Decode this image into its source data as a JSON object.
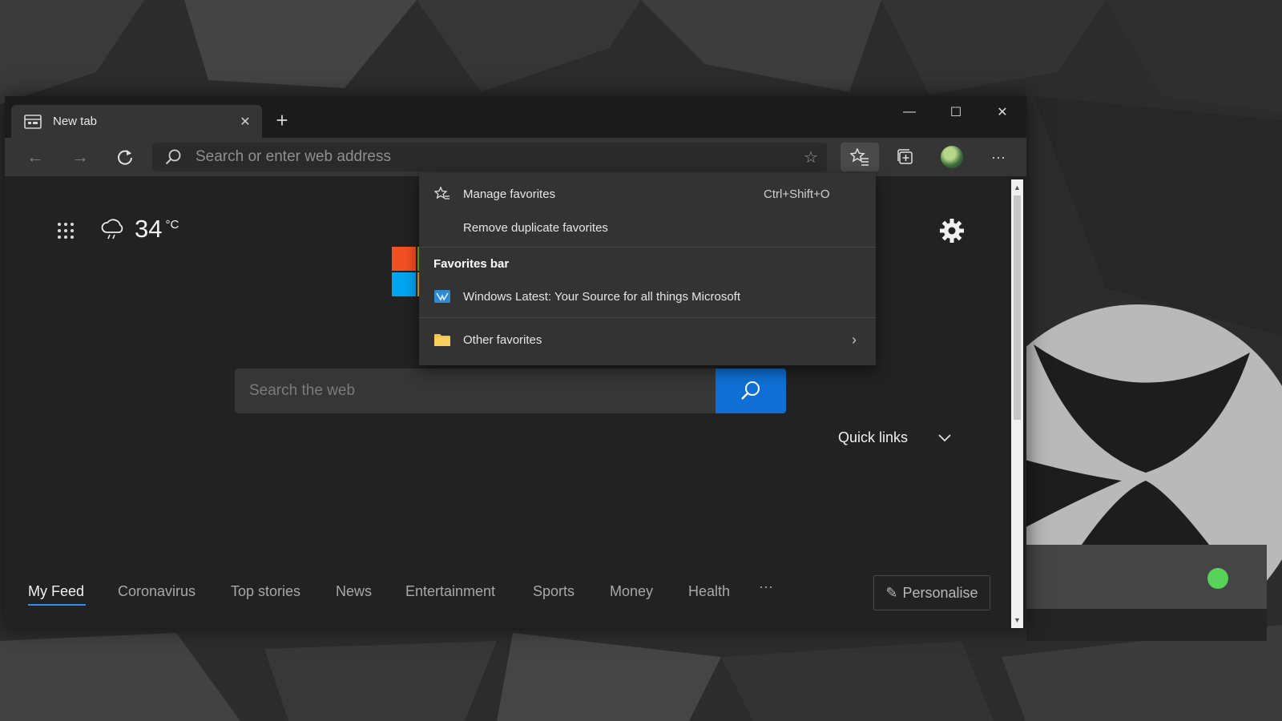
{
  "window": {
    "tab_title": "New tab",
    "tab_close": "✕",
    "new_tab": "+",
    "minimize": "—",
    "maximize": "☐",
    "close": "✕"
  },
  "toolbar": {
    "back": "←",
    "forward": "→",
    "address_placeholder": "Search or enter web address",
    "more": "···"
  },
  "newtab": {
    "temperature": "34",
    "temp_unit": "°C",
    "search_placeholder": "Search the web",
    "quick_links_label": "Quick links",
    "feed_tabs": [
      "My Feed",
      "Coronavirus",
      "Top stories",
      "News",
      "Entertainment",
      "Sports",
      "Money",
      "Health"
    ],
    "feed_more": "···",
    "personalise_label": "Personalise"
  },
  "favorites_menu": {
    "manage_label": "Manage favorites",
    "manage_shortcut": "Ctrl+Shift+O",
    "remove_duplicates_label": "Remove duplicate favorites",
    "bar_heading": "Favorites bar",
    "bar_item_label": "Windows Latest: Your Source for all things Microsoft",
    "other_label": "Other favorites",
    "other_chevron": "›"
  },
  "colors": {
    "accent_blue": "#0f6fd4",
    "ms_red": "#f25022",
    "ms_green": "#7fba00",
    "ms_blue": "#00a4ef",
    "ms_yellow": "#ffb900",
    "status_led": "#58d35a"
  },
  "icons": {
    "tab": "newtab-page-icon",
    "refresh": "refresh-icon",
    "search": "search-icon",
    "star": "star-icon",
    "favorites": "favorites-icon",
    "collections": "collections-icon",
    "apps": "app-launcher-icon",
    "weather": "cloud-rain-icon",
    "settings": "gear-icon",
    "folder": "folder-icon",
    "site": "windows-latest-favicon"
  }
}
